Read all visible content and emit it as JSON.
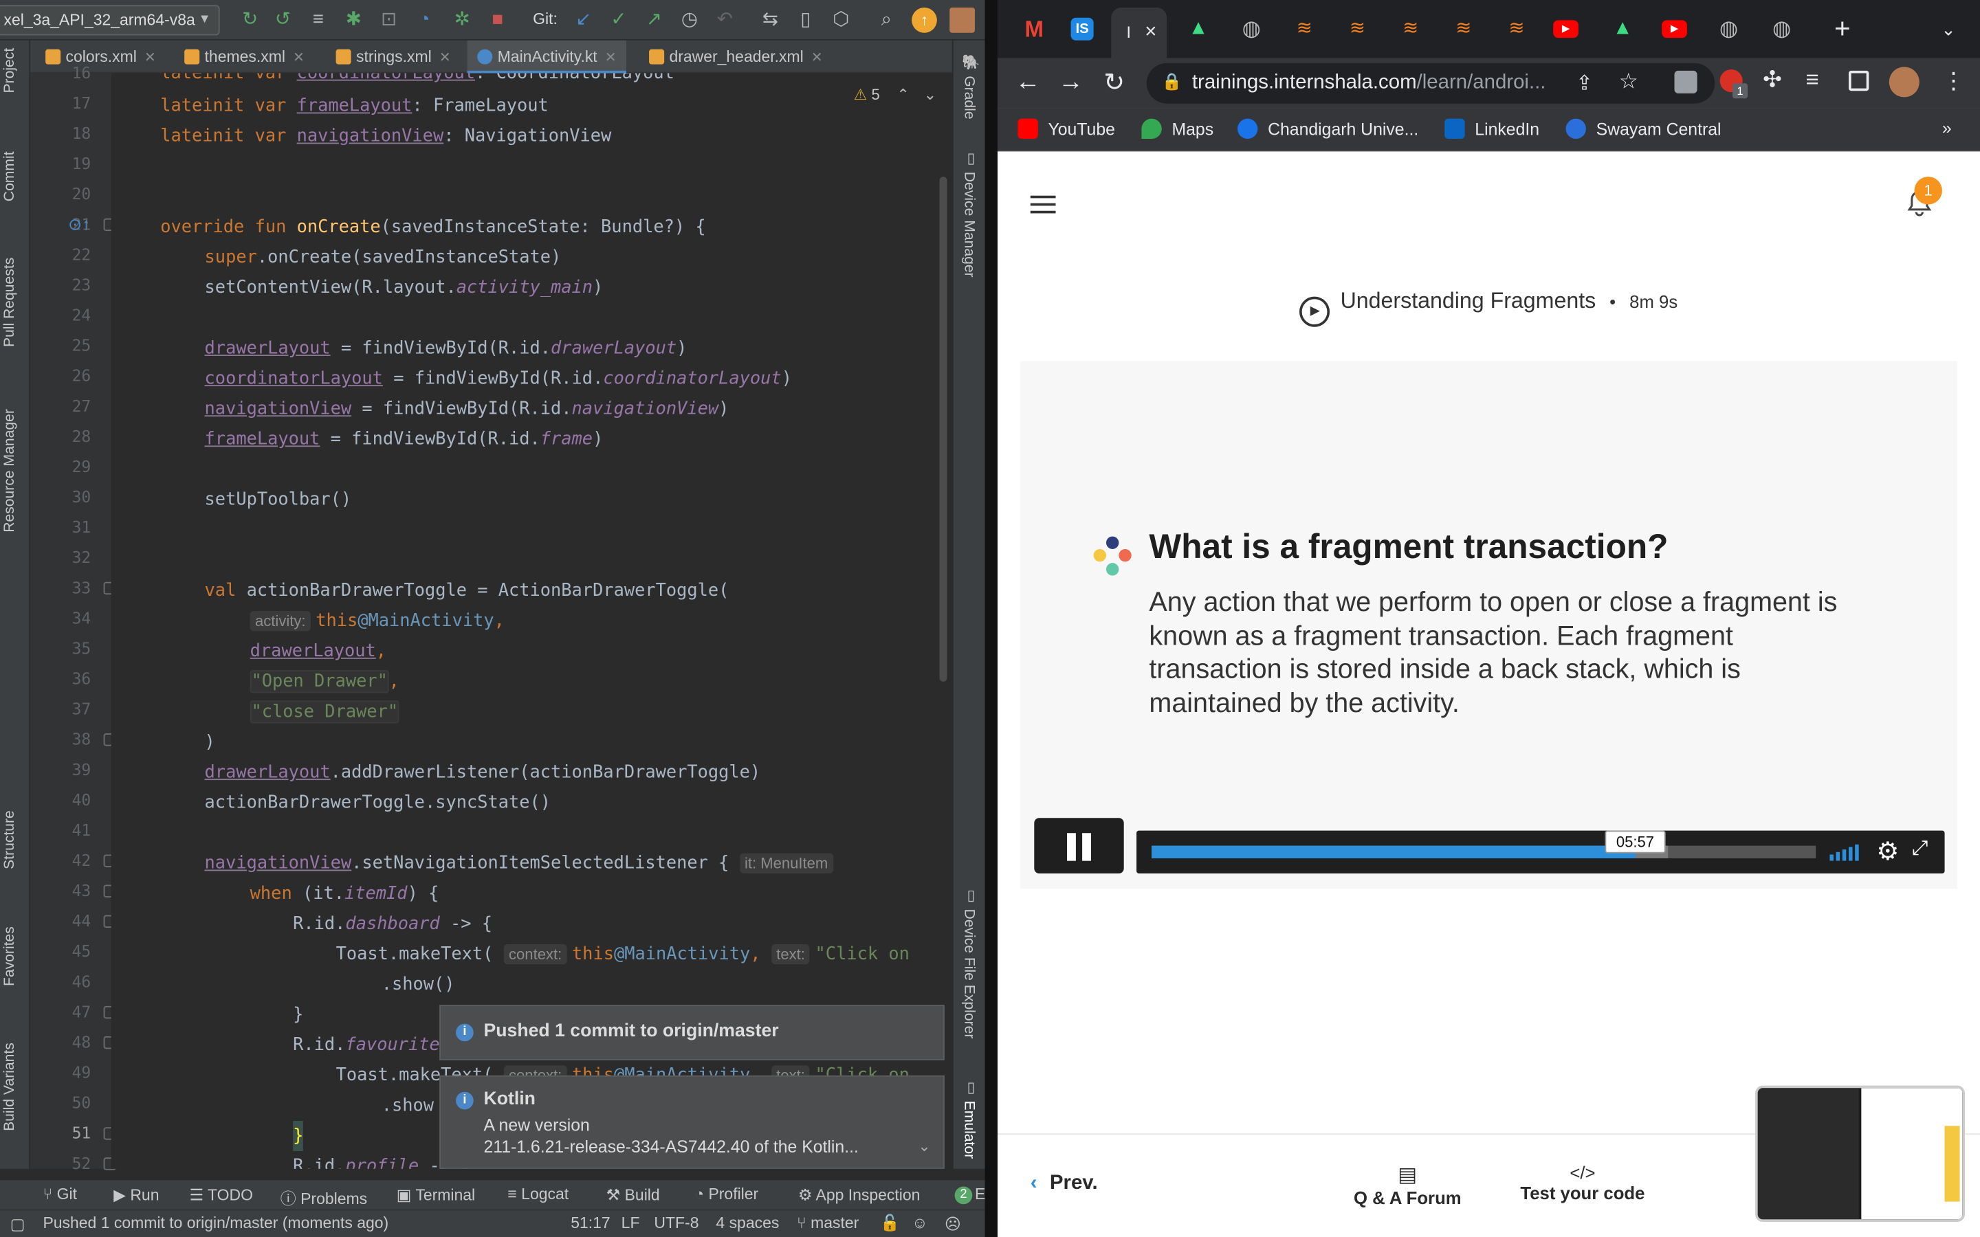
{
  "ide": {
    "device": "xel_3a_API_32_arm64-v8a",
    "git_label": "Git:",
    "tabs": [
      {
        "label": "colors.xml",
        "color": "#e8a33d"
      },
      {
        "label": "themes.xml",
        "color": "#e8a33d"
      },
      {
        "label": "strings.xml",
        "color": "#e8a33d"
      },
      {
        "label": "MainActivity.kt",
        "color": "#4a88c7"
      },
      {
        "label": "drawer_header.xml",
        "color": "#e8a33d"
      }
    ],
    "left_tools": [
      "Project",
      "Commit",
      "Pull Requests",
      "Resource Manager",
      "Structure",
      "Favorites",
      "Build Variants"
    ],
    "right_tools": [
      "Gradle",
      "Device Manager",
      "Device File Explorer",
      "Emulator"
    ],
    "warning_count": "5",
    "line_numbers": [
      "16",
      "17",
      "18",
      "19",
      "20",
      "21",
      "22",
      "23",
      "24",
      "25",
      "26",
      "27",
      "28",
      "29",
      "30",
      "31",
      "32",
      "33",
      "34",
      "35",
      "36",
      "37",
      "38",
      "39",
      "40",
      "41",
      "42",
      "43",
      "44",
      "45",
      "46",
      "47",
      "48",
      "49",
      "50",
      "51",
      "52"
    ],
    "code": {
      "l16_kw": "lateinit var ",
      "l16_prop": "coordinatorLayout",
      "l16_rest": ": CoordinatorLayout",
      "l17_kw": "lateinit var ",
      "l17_prop": "frameLayout",
      "l17_rest": ": FrameLayout",
      "l18_kw": "lateinit var ",
      "l18_prop": "navigationView",
      "l18_rest": ": NavigationView",
      "l21_kw": "override fun ",
      "l21_fn": "onCreate",
      "l21_rest": "(savedInstanceState: Bundle?) {",
      "l22_kw": "super",
      "l22_rest": ".onCreate(savedInstanceState)",
      "l23_a": "setContentView(R.layout.",
      "l23_it": "activity_main",
      "l23_b": ")",
      "l25_prop": "drawerLayout",
      "l25_a": " = findViewById(R.id.",
      "l25_it": "drawerLayout",
      "l25_b": ")",
      "l26_prop": "coordinatorLayout",
      "l26_a": " = findViewById(R.id.",
      "l26_it": "coordinatorLayout",
      "l26_b": ")",
      "l27_prop": "navigationView",
      "l27_a": " = findViewById(R.id.",
      "l27_it": "navigationView",
      "l27_b": ")",
      "l28_prop": "frameLayout",
      "l28_a": " = findViewById(R.id.",
      "l28_it": "frame",
      "l28_b": ")",
      "l30": "setUpToolbar()",
      "l33_kw": "val ",
      "l33_rest": "actionBarDrawerToggle = ActionBarDrawerToggle(",
      "l34_hint": "activity:",
      "l34_kw": "this",
      "l34_at": "@MainActivity",
      "l34_comma": ",",
      "l35_prop": "drawerLayout",
      "l35_comma": ",",
      "l36_str": "\"Open Drawer\"",
      "l36_comma": ",",
      "l37_str": "\"close Drawer\"",
      "l38": ")",
      "l39_prop": "drawerLayout",
      "l39_rest": ".addDrawerListener(actionBarDrawerToggle)",
      "l40": "actionBarDrawerToggle.syncState()",
      "l42_prop": "navigationView",
      "l42_rest": ".setNavigationItemSelectedListener { ",
      "l42_hint": "it: MenuItem",
      "l43_kw": "when ",
      "l43_a": "(it.",
      "l43_it": "itemId",
      "l43_b": ") {",
      "l44_a": "R.id.",
      "l44_it": "dashboard",
      "l44_b": " -> {",
      "l45_a": "Toast.makeText( ",
      "l45_hint": "context:",
      "l45_kw": "this",
      "l45_at": "@MainActivity",
      "l45_comma": ", ",
      "l45_hint2": "text:",
      "l45_str": "\"Click on",
      "l46": ".show()",
      "l47": "}",
      "l48_a": "R.id.",
      "l48_it": "favourite",
      "l49_a": "Toast.makeText( ",
      "l49_hint": "context:",
      "l49_kw": "this",
      "l49_at": "@MainActivity",
      "l49_comma": ", ",
      "l49_hint2": "text:",
      "l49_str": "\"Click on",
      "l50": ".show",
      "l51": "}",
      "l52_a": "R.id.",
      "l52_it": "profile",
      "l52_b": " -> {"
    },
    "notifications": {
      "push": "Pushed 1 commit to origin/master",
      "kotlin_title": "Kotlin",
      "kotlin_line1": "A new version",
      "kotlin_line2": "211-1.6.21-release-334-AS7442.40 of the Kotlin..."
    },
    "bottom_tools": [
      "Git",
      "Run",
      "TODO",
      "Problems",
      "Terminal",
      "Logcat",
      "Build",
      "Profiler",
      "App Inspection"
    ],
    "event_count": "2",
    "event_letter": "E",
    "status": {
      "message": "Pushed 1 commit to origin/master (moments ago)",
      "position": "51:17",
      "line_sep": "LF",
      "encoding": "UTF-8",
      "indent": "4 spaces",
      "branch": "master"
    }
  },
  "browser": {
    "tab_close": "×",
    "new_tab": "+",
    "url_domain": "trainings.internshala.com",
    "url_path": "/learn/androi...",
    "extension_badge": "1",
    "bookmarks": [
      {
        "label": "YouTube",
        "color": "#ff0000"
      },
      {
        "label": "Maps",
        "color": "#34a853"
      },
      {
        "label": "Chandigarh Unive...",
        "color": "#1a73e8"
      },
      {
        "label": "LinkedIn",
        "color": "#0a66c2"
      },
      {
        "label": "Swayam Central",
        "color": "#2a6fdb"
      }
    ],
    "bookmarks_more": "»",
    "notification_count": "1",
    "lesson_title": "Understanding Fragments",
    "lesson_bullet": "•",
    "lesson_duration": "8m 9s",
    "slide_title": "What is a fragment transaction?",
    "slide_body": "Any action that we perform to open or close a fragment is known as a fragment transaction. Each fragment transaction is stored inside a back stack, which is maintained by the activity.",
    "video_time": "05:57",
    "video_progress": 0.728,
    "video_buffered": 0.778,
    "prev_label": "Prev.",
    "forum_label": "Q & A Forum",
    "code_label": "Test your code",
    "accent": "#2d8fd9",
    "badge_color": "#f7941e"
  }
}
